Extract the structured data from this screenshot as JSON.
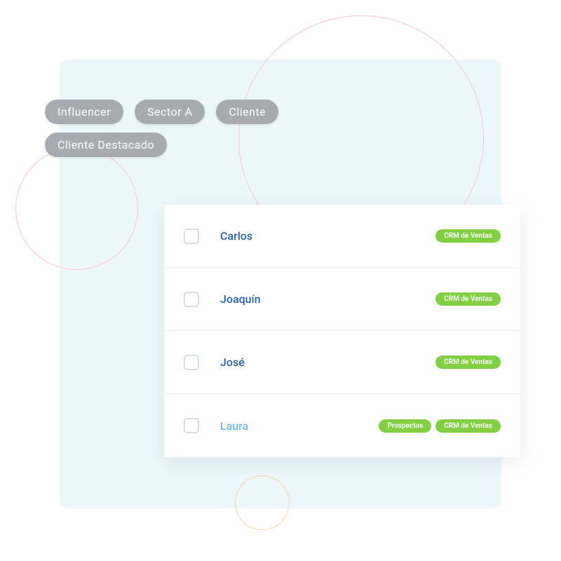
{
  "chips": [
    "Influencer",
    "Sector A",
    "Cliente",
    "Cliente Destacado"
  ],
  "contacts": [
    {
      "name": "Carlos",
      "light": false,
      "badges": [
        "CRM de Ventas"
      ]
    },
    {
      "name": "Joaquín",
      "light": false,
      "badges": [
        "CRM de Ventas"
      ]
    },
    {
      "name": "José",
      "light": false,
      "badges": [
        "CRM de Ventas"
      ]
    },
    {
      "name": "Laura",
      "light": true,
      "badges": [
        "Prospectos",
        "CRM de Ventas"
      ]
    }
  ]
}
